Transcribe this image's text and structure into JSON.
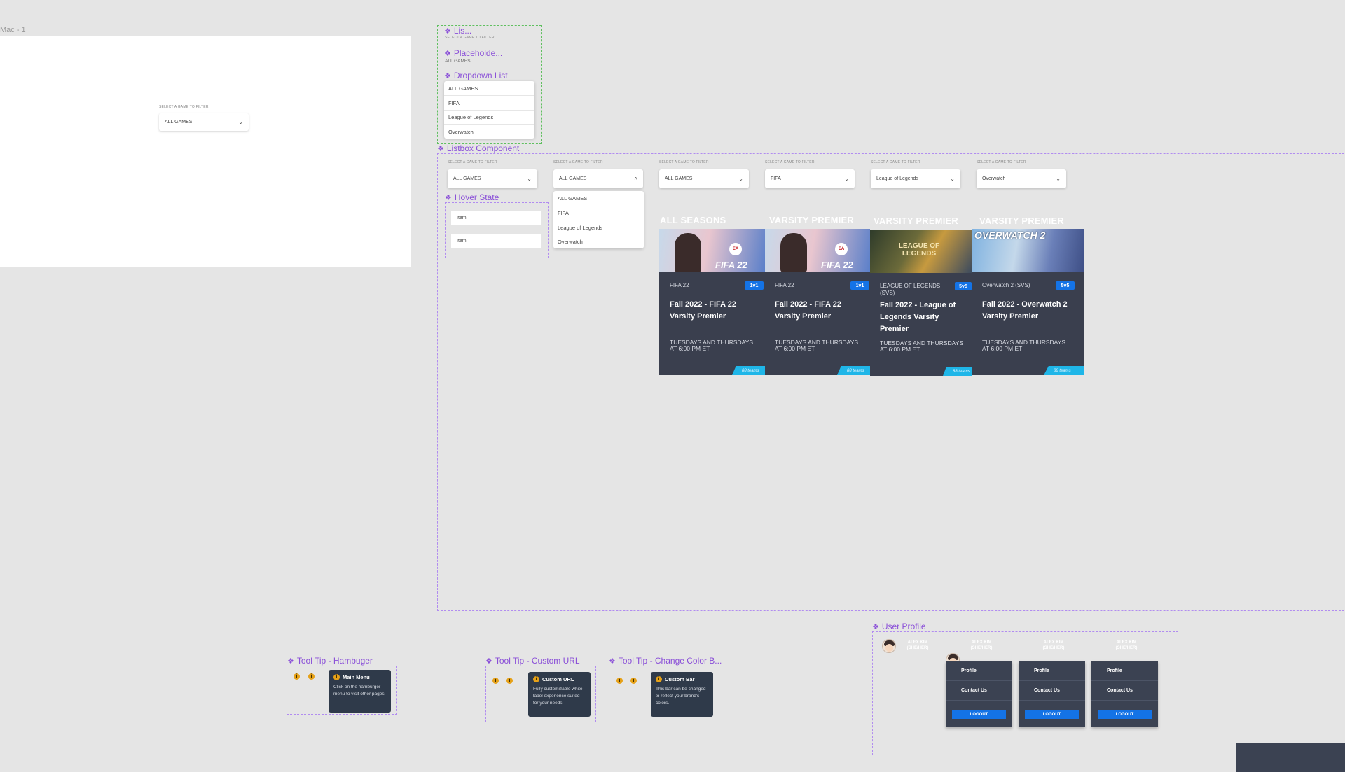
{
  "mac_frame": {
    "label": "Mac - 1",
    "filter_label": "SELECT A GAME TO FILTER",
    "select_value": "ALL GAMES"
  },
  "components": {
    "lis_label": "Lis...",
    "lis_sub": "SELECT A GAME TO FILTER",
    "placeholder_label": "Placeholde...",
    "placeholder_value": "ALL GAMES",
    "dropdown_list_label": "Dropdown List",
    "dropdown_items": [
      "ALL GAMES",
      "FIFA",
      "League of Legends",
      "Overwatch"
    ]
  },
  "listbox": {
    "label": "Listbox Component",
    "filter_label": "SELECT A GAME TO FILTER",
    "selects": [
      "ALL GAMES",
      "ALL GAMES",
      "ALL GAMES",
      "FIFA",
      "League of Legends",
      "Overwatch"
    ],
    "open_menu_items": [
      "ALL GAMES",
      "FIFA",
      "League of Legends",
      "Overwatch"
    ],
    "hover_label": "Hover State",
    "hover_items": [
      "Item",
      "Item"
    ]
  },
  "cards": [
    {
      "season": "ALL SEASONS",
      "game": "FIFA 22",
      "badge": "1v1",
      "title": "Fall 2022 - FIFA 22 Varsity Premier",
      "schedule": "TUESDAYS AND THURSDAYS AT 6:00 PM ET",
      "ribbon": "88 teams",
      "art": "FIFA 22"
    },
    {
      "season": "VARSITY PREMIER",
      "game": "FIFA 22",
      "badge": "1v1",
      "title": "Fall 2022 - FIFA 22 Varsity Premier",
      "schedule": "TUESDAYS AND THURSDAYS AT 6:00 PM ET",
      "ribbon": "88 teams",
      "art": "FIFA 22"
    },
    {
      "season": "VARSITY PREMIER",
      "game": "LEAGUE OF LEGENDS (SVS)",
      "badge": "5v5",
      "title": "Fall 2022 - League of Legends Varsity Premier",
      "schedule": "TUESDAYS AND THURSDAYS AT 6:00 PM ET",
      "ribbon": "88 teams",
      "art": "LEAGUE OF LEGENDS"
    },
    {
      "season": "VARSITY PREMIER",
      "game": "Overwatch 2 (SVS)",
      "badge": "5v5",
      "title": "Fall 2022 - Overwatch 2 Varsity Premier",
      "schedule": "TUESDAYS AND THURSDAYS AT 6:00 PM ET",
      "ribbon": "88 teams",
      "art": "OVERWATCH 2"
    }
  ],
  "tooltips": [
    {
      "label": "Tool Tip - Hambuger",
      "title": "Main Menu",
      "body": "Click on the hamburger menu to visit other pages!"
    },
    {
      "label": "Tool Tip - Custom URL",
      "title": "Custom URL",
      "body": "Fully customizable white label experience suited for your needs!"
    },
    {
      "label": "Tool Tip - Change Color B...",
      "title": "Custom Bar",
      "body": "This bar can be changed to reflect your brand's colors."
    }
  ],
  "user_profile": {
    "label": "User Profile",
    "name": "ALEX KIM (SHE/HER)",
    "menu": [
      "Profile",
      "Contact Us"
    ],
    "logout": "LOGOUT"
  },
  "colors": {
    "accent_purple": "#8a4fd8",
    "card_bg": "#3a3f4e",
    "badge_blue": "#1473e6",
    "ribbon_cyan": "#1fb6e8"
  }
}
